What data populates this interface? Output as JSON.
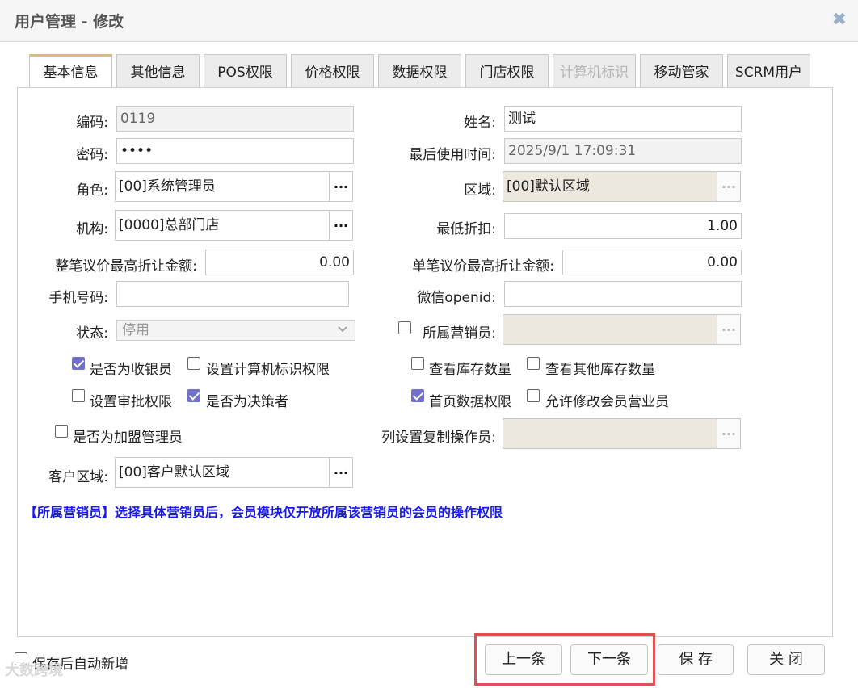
{
  "window": {
    "title": "用户管理 - 修改",
    "close_glyph": "✖"
  },
  "tabs": [
    {
      "label": "基本信息",
      "active": true
    },
    {
      "label": "其他信息"
    },
    {
      "label": "POS权限"
    },
    {
      "label": "价格权限"
    },
    {
      "label": "数据权限"
    },
    {
      "label": "门店权限"
    },
    {
      "label": "计算机标识",
      "disabled": true
    },
    {
      "label": "移动管家"
    },
    {
      "label": "SCRM用户"
    }
  ],
  "form": {
    "code": {
      "label": "编码:",
      "value": "0119"
    },
    "name": {
      "label": "姓名:",
      "value": "测试"
    },
    "password": {
      "label": "密码:",
      "value": "••••"
    },
    "last_used": {
      "label": "最后使用时间:",
      "value": "2025/9/1 17:09:31"
    },
    "role": {
      "label": "角色:",
      "value": "[00]系统管理员"
    },
    "region": {
      "label": "区域:",
      "value": "[00]默认区域"
    },
    "org": {
      "label": "机构:",
      "value": "[0000]总部门店"
    },
    "min_discount": {
      "label": "最低折扣:",
      "value": "1.00"
    },
    "whole_max": {
      "label": "整笔议价最高折让金额:",
      "value": "0.00"
    },
    "single_max": {
      "label": "单笔议价最高折让金额:",
      "value": "0.00"
    },
    "phone": {
      "label": "手机号码:",
      "value": ""
    },
    "wechat": {
      "label": "微信openid:",
      "value": ""
    },
    "status": {
      "label": "状态:",
      "value": "停用"
    },
    "salesman": {
      "label": "所属营销员:",
      "value": ""
    },
    "copy_operator": {
      "label": "列设置复制操作员:",
      "value": ""
    },
    "customer_region": {
      "label": "客户区域:",
      "value": "[00]客户默认区域"
    },
    "dots": "..."
  },
  "checkboxes": {
    "cashier": {
      "label": "是否为收银员",
      "checked": true
    },
    "computer_id_perm": {
      "label": "设置计算机标识权限",
      "checked": false
    },
    "view_stock": {
      "label": "查看库存数量",
      "checked": false
    },
    "view_other_stock": {
      "label": "查看其他库存数量",
      "checked": false
    },
    "approval_perm": {
      "label": "设置审批权限",
      "checked": false
    },
    "decision_maker": {
      "label": "是否为决策者",
      "checked": true
    },
    "home_data_perm": {
      "label": "首页数据权限",
      "checked": true
    },
    "allow_edit_member_rep": {
      "label": "允许修改会员营业员",
      "checked": false
    },
    "franchise_admin": {
      "label": "是否为加盟管理员",
      "checked": false
    },
    "auto_new": {
      "label": "保存后自动新增",
      "checked": false
    }
  },
  "note": "【所属营销员】选择具体营销员后，会员模块仅开放所属该营销员的会员的操作权限",
  "footer": {
    "prev": "上一条",
    "next": "下一条",
    "save": "保 存",
    "close": "关 闭"
  },
  "watermark": "大数跨境",
  "colors": {
    "accent_tab": "#dcb980",
    "note": "#1a1aee",
    "highlight": "#e05050",
    "checked": "#7070c8"
  }
}
